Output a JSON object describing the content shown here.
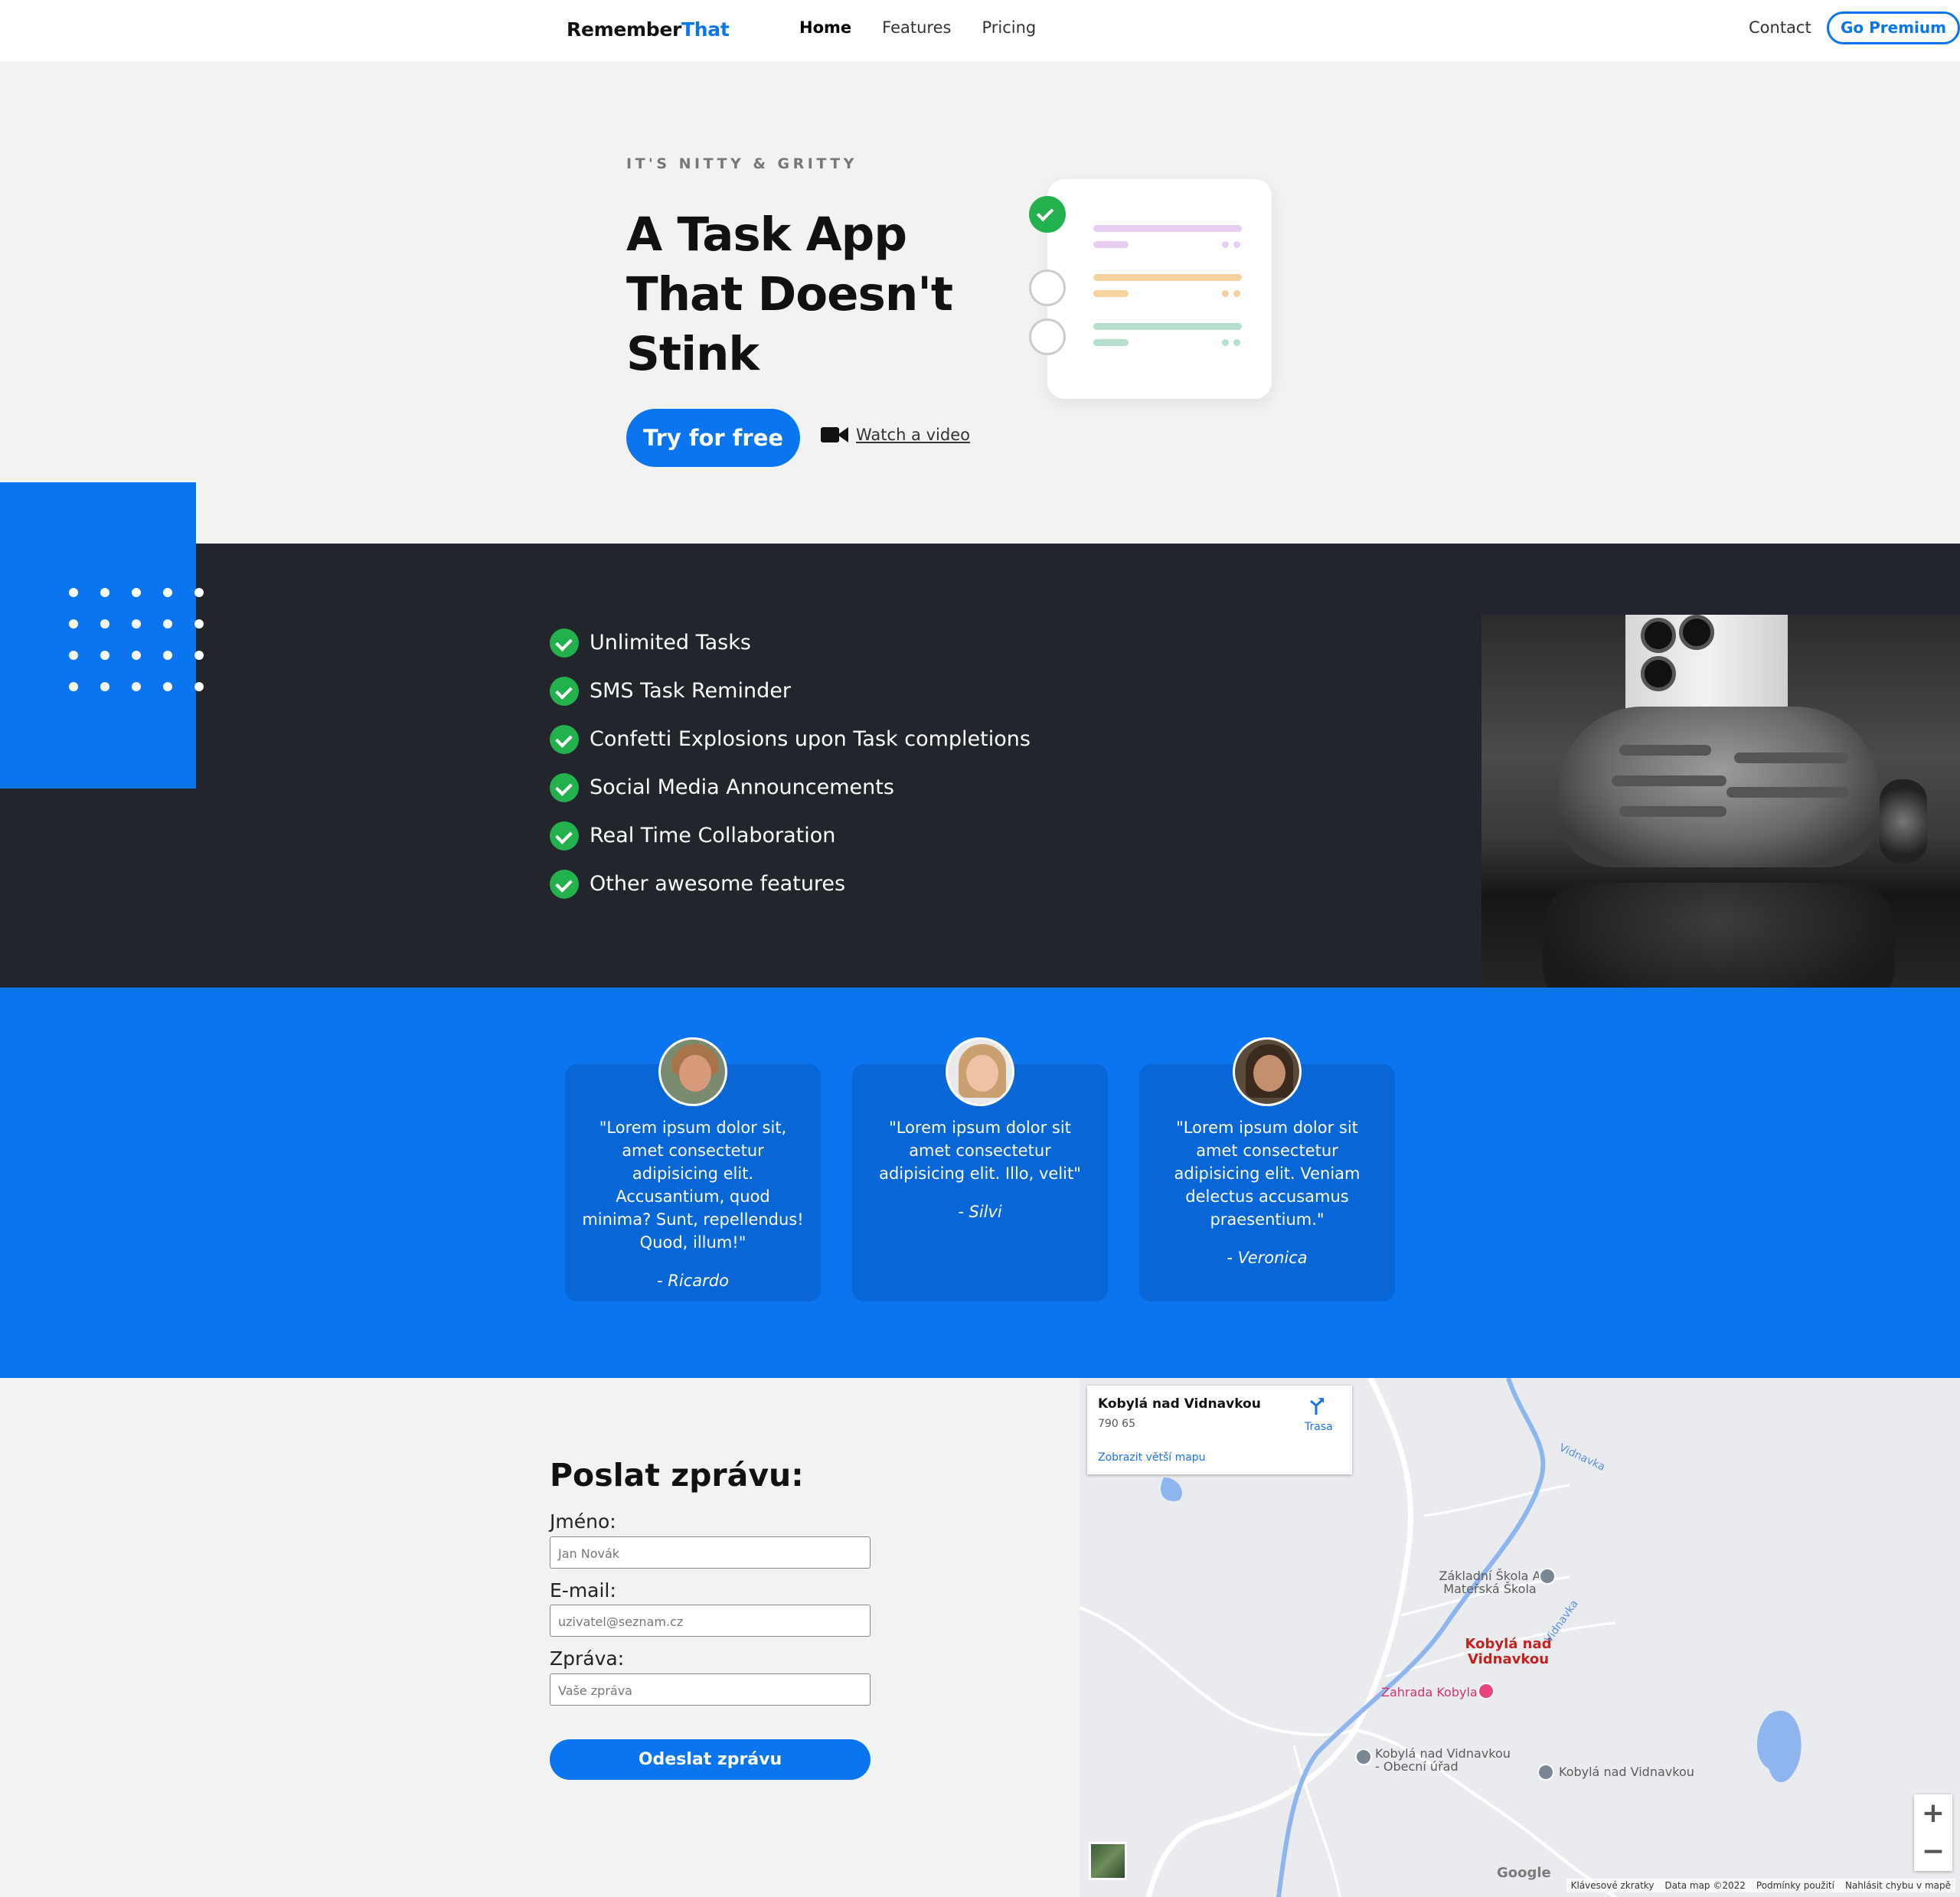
{
  "nav": {
    "logo_part1": "Remember",
    "logo_part2": "That",
    "links": [
      "Home",
      "Features",
      "Pricing"
    ],
    "contact": "Contact",
    "premium": "Go Premium"
  },
  "hero": {
    "eyebrow": "IT'S NITTY & GRITTY",
    "title": "A Task App That Doesn't Stink",
    "cta": "Try for free",
    "video_link": "Watch a video"
  },
  "features": [
    "Unlimited Tasks",
    "SMS Task Reminder",
    "Confetti Explosions upon Task completions",
    "Social Media Announcements",
    "Real Time Collaboration",
    "Other awesome features"
  ],
  "testimonials": [
    {
      "quote": "\"Lorem ipsum dolor sit, amet consectetur adipisicing elit. Accusantium, quod minima? Sunt, repellendus! Quod, illum!\"",
      "name": "- Ricardo"
    },
    {
      "quote": "\"Lorem ipsum dolor sit amet consectetur adipisicing elit. Illo, velit\"",
      "name": "- Silvi"
    },
    {
      "quote": "\"Lorem ipsum dolor sit amet consectetur adipisicing elit. Veniam delectus accusamus praesentium.\"",
      "name": "- Veronica"
    }
  ],
  "form": {
    "title": "Poslat zprávu:",
    "name_label": "Jméno:",
    "name_placeholder": "Jan Novák",
    "email_label": "E-mail:",
    "email_placeholder": "uzivatel@seznam.cz",
    "message_label": "Zpráva:",
    "message_placeholder": "Vaše zpráva",
    "submit": "Odeslat zprávu"
  },
  "map": {
    "place_title": "Kobylá nad Vidnavkou",
    "zip": "790 65",
    "route": "Trasa",
    "bigger_map": "Zobrazit větší mapu",
    "labels": {
      "school": "Základní Škola A Mateřská Škola",
      "village": "Kobylá nad Vidnavkou",
      "garden": "Zahrada Kobyla",
      "office": "Kobylá nad Vidnavkou - Obecní úřad",
      "place2": "Kobylá nad Vidnavkou",
      "river": "Vidnavka"
    },
    "google": "Google",
    "footer": [
      "Klávesové zkratky",
      "Data map ©2022",
      "Podmínky použití",
      "Nahlásit chybu v mapě"
    ]
  },
  "colors": {
    "accent": "#0a75ef",
    "dark": "#22262c",
    "check": "#22b14c"
  }
}
